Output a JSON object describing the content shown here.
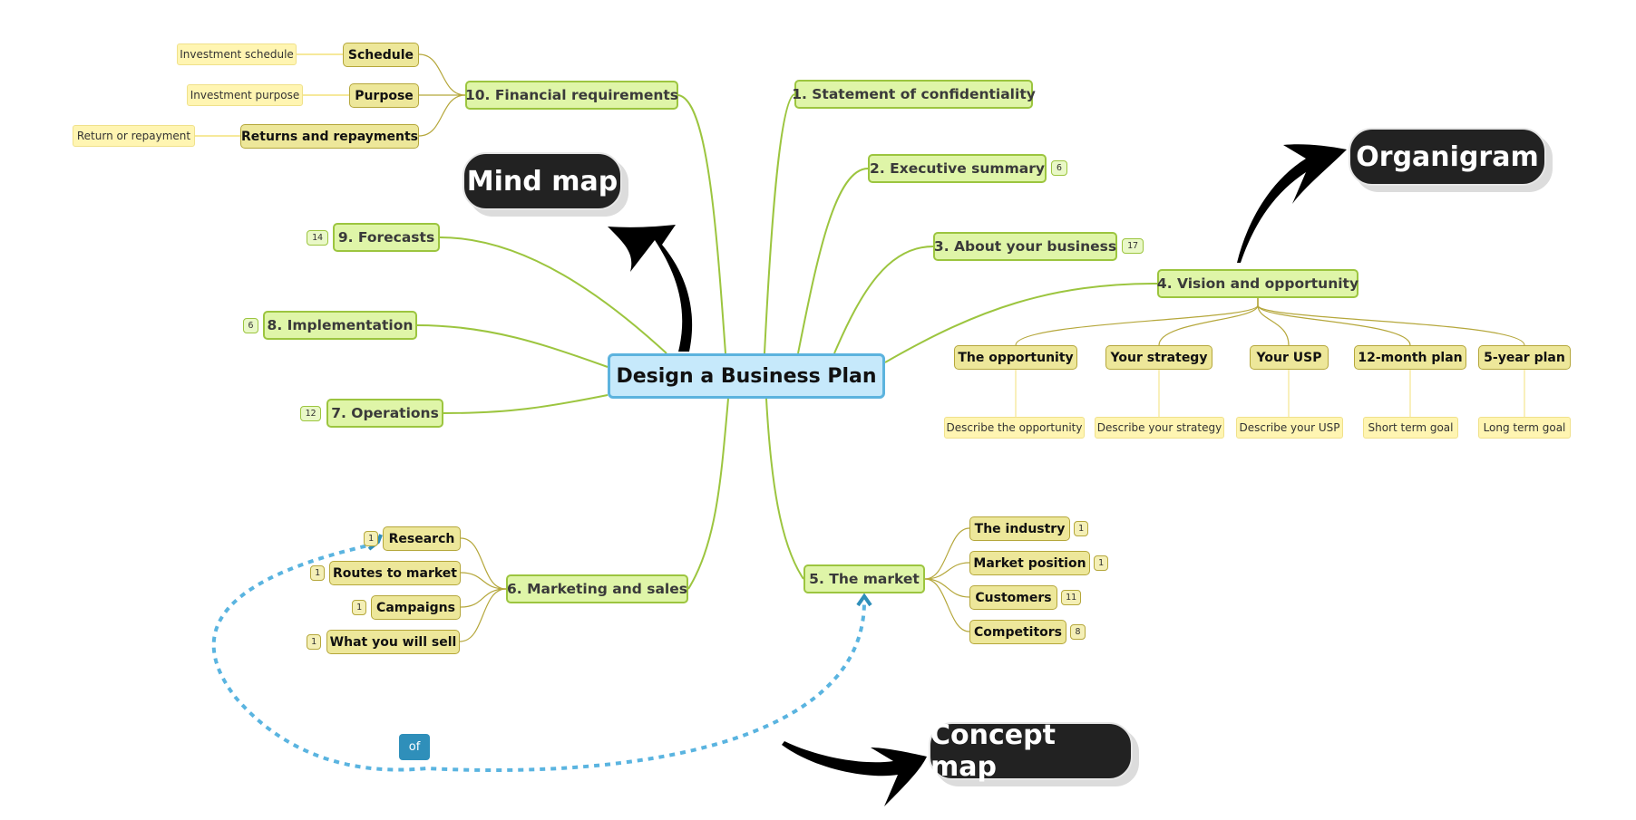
{
  "central": {
    "label": "Design a Business Plan"
  },
  "colors": {
    "central_fill": "#c6e9fb",
    "central_border": "#5cb3de",
    "main_fill": "#dff5a8",
    "main_border": "#9cc53f",
    "sub_fill": "#ede79a",
    "sub_border": "#b5a73b",
    "leaf_fill": "#fff5b2",
    "relationship": "#5ab4e0",
    "callout_fill": "#222222"
  },
  "topics": [
    {
      "label": "1. Statement of confidentiality"
    },
    {
      "label": "2. Executive summary",
      "count": "6"
    },
    {
      "label": "3. About your business",
      "count": "17"
    },
    {
      "label": "4. Vision and opportunity",
      "children": [
        {
          "label": "The opportunity",
          "note": "Describe the opportunity"
        },
        {
          "label": "Your strategy",
          "note": "Describe your strategy"
        },
        {
          "label": "Your USP",
          "note": "Describe your USP"
        },
        {
          "label": "12-month plan",
          "note": "Short term goal"
        },
        {
          "label": "5-year plan",
          "note": "Long term goal"
        }
      ]
    },
    {
      "label": "5. The market",
      "children": [
        {
          "label": "The industry",
          "count": "1"
        },
        {
          "label": "Market position",
          "count": "1"
        },
        {
          "label": "Customers",
          "count": "11"
        },
        {
          "label": "Competitors",
          "count": "8"
        }
      ]
    },
    {
      "label": "6. Marketing and sales",
      "children": [
        {
          "label": "Research",
          "count": "1"
        },
        {
          "label": "Routes to market",
          "count": "1"
        },
        {
          "label": "Campaigns",
          "count": "1"
        },
        {
          "label": "What you will sell",
          "count": "1"
        }
      ]
    },
    {
      "label": "7. Operations",
      "count": "12"
    },
    {
      "label": "8. Implementation",
      "count": "6"
    },
    {
      "label": "9. Forecasts",
      "count": "14"
    },
    {
      "label": "10. Financial requirements",
      "children": [
        {
          "label": "Schedule",
          "note": "Investment schedule"
        },
        {
          "label": "Purpose",
          "note": "Investment purpose"
        },
        {
          "label": "Returns and repayments",
          "note": "Return or repayment"
        }
      ]
    }
  ],
  "relationship": {
    "label": "of",
    "from": "Research",
    "to": "5. The market"
  },
  "callouts": [
    {
      "label": "Mind map"
    },
    {
      "label": "Organigram"
    },
    {
      "label": "Concept map"
    }
  ]
}
